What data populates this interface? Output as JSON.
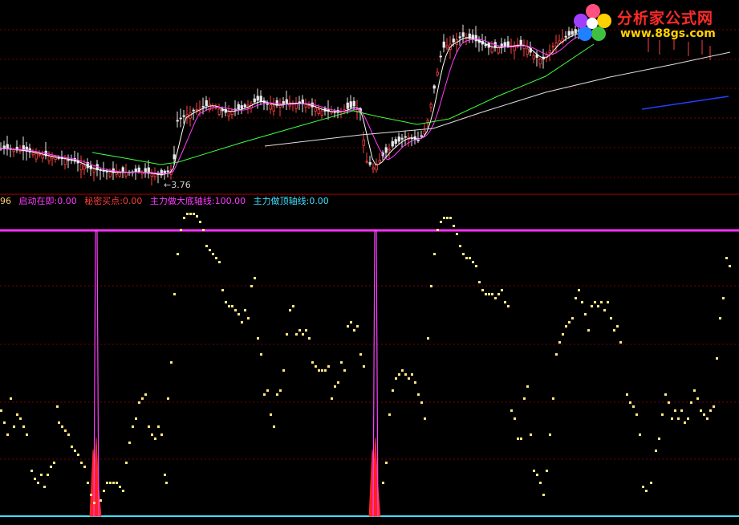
{
  "chart_data": [
    {
      "type": "candlestick",
      "panel": "price",
      "low_annotation": "←3.76",
      "series": [
        {
          "name": "",
          "color": "#ffffff",
          "kind": "ma"
        },
        {
          "name": "",
          "color": "#ff40ff",
          "kind": "ma"
        },
        {
          "name": "",
          "color": "#40ff40",
          "kind": "ma"
        },
        {
          "name": "",
          "color": "#e0e0e0",
          "kind": "ma"
        },
        {
          "name": "",
          "color": "#2040ff",
          "kind": "ma"
        }
      ]
    },
    {
      "type": "scatter",
      "panel": "indicator",
      "legend_prefix": "96",
      "legend": [
        {
          "label": "启动在即:0.00",
          "color": "#ff3cff"
        },
        {
          "label": "秘密买点:0.00",
          "color": "#ff3c3c"
        },
        {
          "label": "主力做大底轴线:100.00",
          "color": "#ff3cff"
        },
        {
          "label": "主力做顶轴线:0.00",
          "color": "#40e0ff"
        }
      ],
      "top_axis_value": 100,
      "bottom_axis_value": 0,
      "colors": {
        "dots": "#ffe680",
        "top_line": "#ff30ff",
        "bottom_line": "#40e0ff",
        "spike": "#ff40ff",
        "spike_fill": "#ff2020"
      },
      "spike_positions": [
        120,
        468
      ],
      "dots_y": [
        [
          0,
          510
        ],
        [
          4,
          525
        ],
        [
          8,
          540
        ],
        [
          12,
          495
        ],
        [
          16,
          530
        ],
        [
          20,
          515
        ],
        [
          24,
          520
        ],
        [
          28,
          530
        ],
        [
          32,
          540
        ],
        [
          38,
          585
        ],
        [
          42,
          595
        ],
        [
          46,
          600
        ],
        [
          50,
          590
        ],
        [
          54,
          605
        ],
        [
          58,
          590
        ],
        [
          62,
          580
        ],
        [
          66,
          575
        ],
        [
          70,
          505
        ],
        [
          72,
          525
        ],
        [
          76,
          530
        ],
        [
          80,
          535
        ],
        [
          84,
          540
        ],
        [
          88,
          555
        ],
        [
          92,
          560
        ],
        [
          96,
          565
        ],
        [
          100,
          575
        ],
        [
          104,
          580
        ],
        [
          108,
          600
        ],
        [
          112,
          615
        ],
        [
          116,
          625
        ],
        [
          124,
          622
        ],
        [
          128,
          610
        ],
        [
          132,
          600
        ],
        [
          136,
          600
        ],
        [
          140,
          600
        ],
        [
          144,
          600
        ],
        [
          148,
          605
        ],
        [
          152,
          610
        ],
        [
          156,
          575
        ],
        [
          160,
          550
        ],
        [
          164,
          530
        ],
        [
          168,
          520
        ],
        [
          172,
          500
        ],
        [
          176,
          495
        ],
        [
          180,
          490
        ],
        [
          184,
          530
        ],
        [
          188,
          540
        ],
        [
          192,
          545
        ],
        [
          196,
          530
        ],
        [
          200,
          540
        ],
        [
          204,
          590
        ],
        [
          206,
          600
        ],
        [
          208,
          495
        ],
        [
          212,
          450
        ],
        [
          216,
          365
        ],
        [
          220,
          315
        ],
        [
          224,
          285
        ],
        [
          228,
          270
        ],
        [
          232,
          265
        ],
        [
          236,
          265
        ],
        [
          240,
          265
        ],
        [
          244,
          268
        ],
        [
          248,
          275
        ],
        [
          252,
          285
        ],
        [
          256,
          305
        ],
        [
          260,
          310
        ],
        [
          264,
          315
        ],
        [
          268,
          320
        ],
        [
          272,
          325
        ],
        [
          276,
          360
        ],
        [
          280,
          375
        ],
        [
          284,
          380
        ],
        [
          288,
          380
        ],
        [
          292,
          385
        ],
        [
          296,
          390
        ],
        [
          300,
          400
        ],
        [
          304,
          385
        ],
        [
          308,
          395
        ],
        [
          312,
          355
        ],
        [
          316,
          345
        ],
        [
          320,
          420
        ],
        [
          324,
          440
        ],
        [
          328,
          490
        ],
        [
          332,
          485
        ],
        [
          336,
          515
        ],
        [
          340,
          530
        ],
        [
          344,
          490
        ],
        [
          348,
          485
        ],
        [
          352,
          460
        ],
        [
          356,
          415
        ],
        [
          360,
          385
        ],
        [
          364,
          380
        ],
        [
          368,
          415
        ],
        [
          372,
          410
        ],
        [
          376,
          415
        ],
        [
          380,
          410
        ],
        [
          384,
          420
        ],
        [
          388,
          450
        ],
        [
          392,
          455
        ],
        [
          396,
          460
        ],
        [
          400,
          460
        ],
        [
          404,
          460
        ],
        [
          408,
          455
        ],
        [
          412,
          495
        ],
        [
          416,
          480
        ],
        [
          420,
          475
        ],
        [
          424,
          450
        ],
        [
          428,
          460
        ],
        [
          432,
          405
        ],
        [
          436,
          400
        ],
        [
          440,
          410
        ],
        [
          444,
          405
        ],
        [
          448,
          440
        ],
        [
          452,
          455
        ],
        [
          476,
          600
        ],
        [
          480,
          575
        ],
        [
          484,
          515
        ],
        [
          488,
          485
        ],
        [
          492,
          470
        ],
        [
          496,
          465
        ],
        [
          500,
          460
        ],
        [
          504,
          465
        ],
        [
          508,
          470
        ],
        [
          512,
          465
        ],
        [
          516,
          475
        ],
        [
          520,
          490
        ],
        [
          524,
          500
        ],
        [
          528,
          520
        ],
        [
          532,
          420
        ],
        [
          536,
          355
        ],
        [
          540,
          315
        ],
        [
          544,
          285
        ],
        [
          548,
          275
        ],
        [
          552,
          270
        ],
        [
          556,
          270
        ],
        [
          560,
          270
        ],
        [
          564,
          280
        ],
        [
          568,
          290
        ],
        [
          572,
          305
        ],
        [
          576,
          315
        ],
        [
          580,
          320
        ],
        [
          584,
          320
        ],
        [
          588,
          325
        ],
        [
          592,
          330
        ],
        [
          596,
          350
        ],
        [
          600,
          360
        ],
        [
          604,
          365
        ],
        [
          608,
          365
        ],
        [
          612,
          365
        ],
        [
          616,
          370
        ],
        [
          620,
          365
        ],
        [
          624,
          360
        ],
        [
          628,
          375
        ],
        [
          632,
          380
        ],
        [
          636,
          510
        ],
        [
          640,
          520
        ],
        [
          644,
          545
        ],
        [
          648,
          545
        ],
        [
          652,
          495
        ],
        [
          656,
          480
        ],
        [
          660,
          540
        ],
        [
          664,
          585
        ],
        [
          668,
          590
        ],
        [
          672,
          600
        ],
        [
          676,
          615
        ],
        [
          680,
          585
        ],
        [
          684,
          540
        ],
        [
          688,
          495
        ],
        [
          692,
          440
        ],
        [
          696,
          425
        ],
        [
          700,
          415
        ],
        [
          704,
          405
        ],
        [
          708,
          400
        ],
        [
          712,
          395
        ],
        [
          716,
          370
        ],
        [
          720,
          360
        ],
        [
          724,
          375
        ],
        [
          728,
          390
        ],
        [
          732,
          410
        ],
        [
          736,
          380
        ],
        [
          740,
          375
        ],
        [
          744,
          380
        ],
        [
          748,
          375
        ],
        [
          752,
          385
        ],
        [
          756,
          375
        ],
        [
          760,
          395
        ],
        [
          764,
          410
        ],
        [
          768,
          405
        ],
        [
          772,
          425
        ],
        [
          780,
          490
        ],
        [
          784,
          500
        ],
        [
          788,
          505
        ],
        [
          792,
          515
        ],
        [
          796,
          540
        ],
        [
          800,
          605
        ],
        [
          804,
          610
        ],
        [
          810,
          600
        ],
        [
          816,
          560
        ],
        [
          820,
          545
        ],
        [
          824,
          515
        ],
        [
          828,
          490
        ],
        [
          832,
          500
        ],
        [
          836,
          520
        ],
        [
          840,
          510
        ],
        [
          844,
          520
        ],
        [
          848,
          510
        ],
        [
          852,
          525
        ],
        [
          856,
          520
        ],
        [
          860,
          500
        ],
        [
          864,
          485
        ],
        [
          868,
          495
        ],
        [
          872,
          510
        ],
        [
          876,
          515
        ],
        [
          880,
          520
        ],
        [
          884,
          510
        ],
        [
          888,
          505
        ],
        [
          892,
          445
        ],
        [
          896,
          395
        ],
        [
          900,
          370
        ],
        [
          904,
          320
        ],
        [
          908,
          330
        ]
      ]
    }
  ],
  "logo": {
    "name": "分析家公式网",
    "url": "www.88gs.com"
  }
}
